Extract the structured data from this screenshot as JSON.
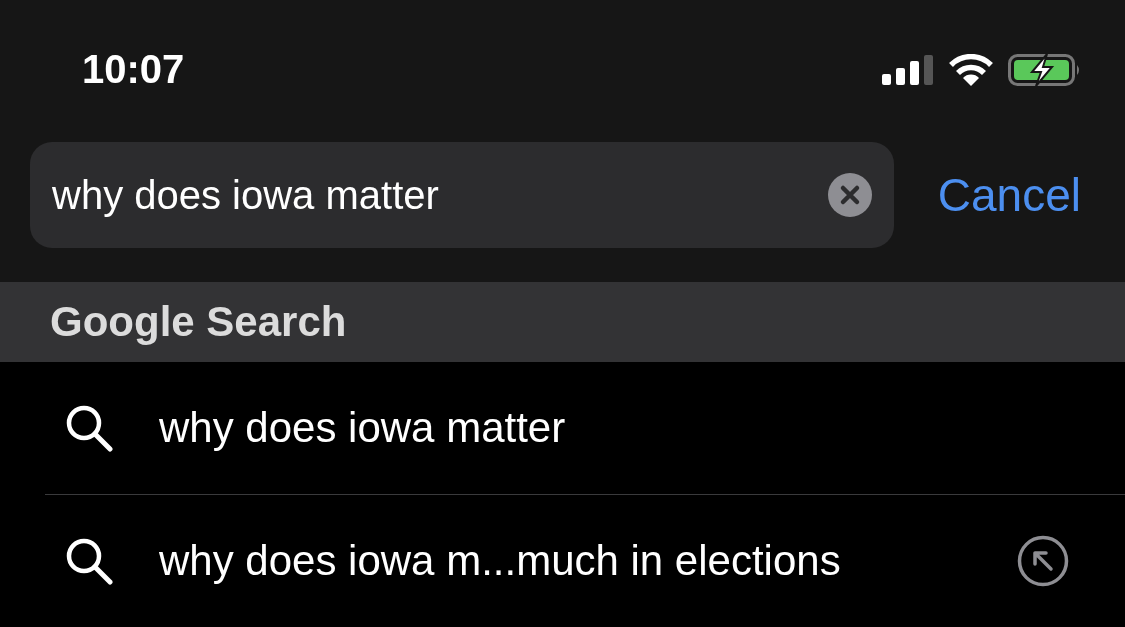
{
  "status_bar": {
    "time": "10:07"
  },
  "search": {
    "value": "why does iowa matter",
    "cancel": "Cancel"
  },
  "section_header": "Google Search",
  "suggestions": [
    {
      "text": "why does iowa matter",
      "fill_in": false
    },
    {
      "text": "why does iowa m...much in elections",
      "fill_in": true
    }
  ]
}
